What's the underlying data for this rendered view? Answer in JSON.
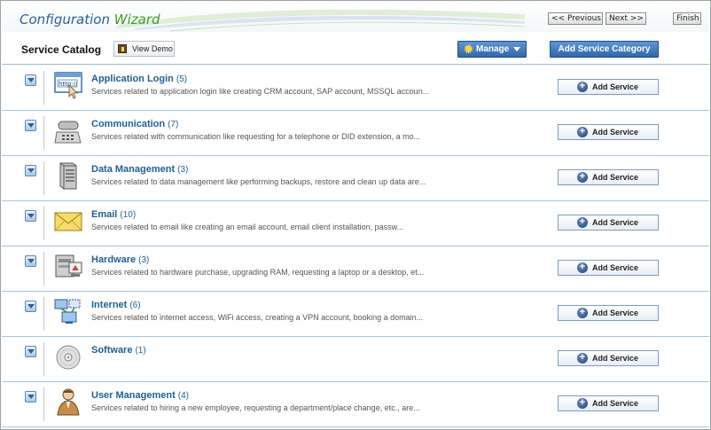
{
  "header": {
    "title_part1": "Configuration",
    "title_part2": "Wizard",
    "prev_label": "<< Previous",
    "next_label": "Next >>",
    "finish_label": "Finish"
  },
  "toolbar": {
    "catalog_title": "Service Catalog",
    "view_demo_label": "View Demo",
    "manage_label": "Manage",
    "add_category_label": "Add Service Category"
  },
  "colors": {
    "title_blue": "#2c5f94",
    "title_green": "#3e9a2c",
    "link_blue": "#1f5f92",
    "button_blue": "#2f68ad",
    "row_divider": "#a7c4dc"
  },
  "categories": [
    {
      "name": "Application Login",
      "count": "(5)",
      "description": "Services related to application login like creating CRM account, SAP account, MSSQL accoun...",
      "icon": "browser-login-icon",
      "button": "Add Service"
    },
    {
      "name": "Communication",
      "count": "(7)",
      "description": "Services related with communication like requesting for a telephone or DID extension, a mo...",
      "icon": "telephone-icon",
      "button": "Add Service"
    },
    {
      "name": "Data Management",
      "count": "(3)",
      "description": "Services related to data management like performing backups, restore and clean up data are...",
      "icon": "server-icon",
      "button": "Add Service"
    },
    {
      "name": "Email",
      "count": "(10)",
      "description": "Services related to email like creating an email account, email client installation, passw...",
      "icon": "envelope-icon",
      "button": "Add Service"
    },
    {
      "name": "Hardware",
      "count": "(3)",
      "description": "Services related to hardware purchase, upgrading RAM, requesting a laptop or a desktop, et...",
      "icon": "hardware-icon",
      "button": "Add Service"
    },
    {
      "name": "Internet",
      "count": "(6)",
      "description": "Services related to internet access, WiFi access, creating a VPN account, booking a domain...",
      "icon": "network-icon",
      "button": "Add Service"
    },
    {
      "name": "Software",
      "count": "(1)",
      "description": "",
      "icon": "cd-disc-icon",
      "button": "Add Service"
    },
    {
      "name": "User Management",
      "count": "(4)",
      "description": "Services related to hiring a new employee, requesting a department/place change, etc., are...",
      "icon": "user-icon",
      "button": "Add Service"
    }
  ]
}
